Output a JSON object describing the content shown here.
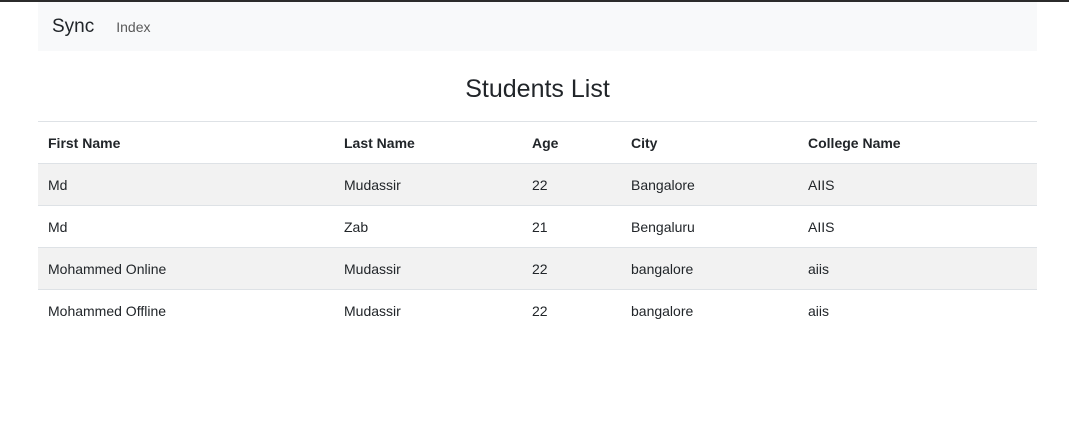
{
  "navbar": {
    "brand": "Sync",
    "links": [
      "Index"
    ]
  },
  "page": {
    "title": "Students List"
  },
  "table": {
    "headers": [
      "First Name",
      "Last Name",
      "Age",
      "City",
      "College Name"
    ],
    "rows": [
      [
        "Md",
        "Mudassir",
        "22",
        "Bangalore",
        "AIIS"
      ],
      [
        "Md",
        "Zab",
        "21",
        "Bengaluru",
        "AIIS"
      ],
      [
        "Mohammed Online",
        "Mudassir",
        "22",
        "bangalore",
        "aiis"
      ],
      [
        "Mohammed Offline",
        "Mudassir",
        "22",
        "bangalore",
        "aiis"
      ]
    ]
  },
  "colors": {
    "navbar_bg": "#f8f9fa",
    "stripe_bg": "#f2f2f2",
    "border": "#dee2e6",
    "text": "#212529"
  }
}
